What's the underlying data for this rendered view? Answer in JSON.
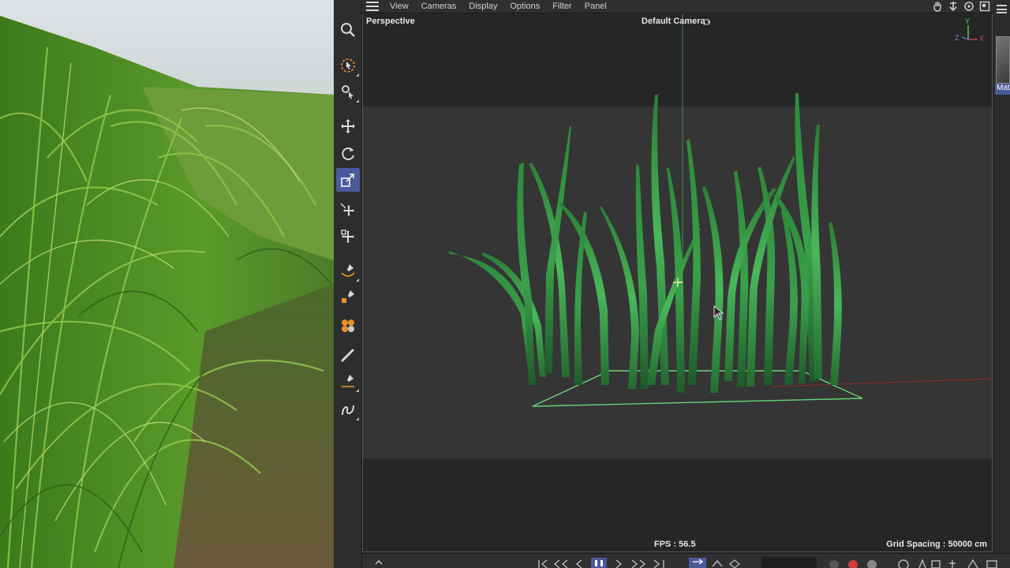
{
  "menu": {
    "items": [
      "View",
      "Cameras",
      "Display",
      "Options",
      "Filter",
      "Panel"
    ]
  },
  "viewport": {
    "view_name": "Perspective",
    "camera_name": "Default Camera",
    "fps": "FPS : 56.5",
    "grid_spacing": "Grid Spacing : 50000 cm"
  },
  "axis": {
    "y": "Y",
    "z": "Z",
    "x": "X"
  },
  "material": {
    "label": "Mat"
  },
  "tools": [
    "search-icon",
    "live-selection-icon",
    "selection-settings-icon",
    "move-icon",
    "rotate-icon",
    "scale-icon",
    "transfer-icon",
    "snap-icon",
    "spline-pen-icon",
    "sketch-pen-icon",
    "mograph-icon",
    "brush-icon",
    "knife-icon",
    "spline-icon"
  ],
  "colors": {
    "accent": "#4b5a9c",
    "grass": "#3aa04a",
    "ui_bg": "#2a2a2a"
  }
}
